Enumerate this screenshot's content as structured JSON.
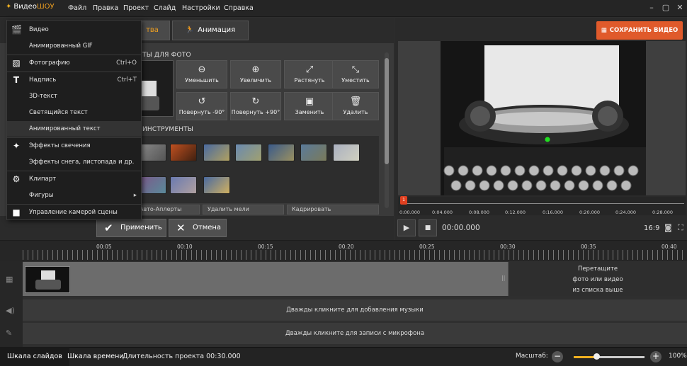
{
  "app": {
    "title_prefix": "Видео",
    "title_suffix": "ШОУ"
  },
  "menu": [
    "Файл",
    "Правка",
    "Проект",
    "Слайд",
    "Настройки",
    "Справка"
  ],
  "tabs": {
    "active_partial": "тва",
    "animation": "Анимация"
  },
  "sections": {
    "photo_actions": "ТЫ ДЛЯ ФОТО",
    "tools": "ИНСТРУМЕНТЫ"
  },
  "tools": [
    {
      "label": "Уменьшить",
      "icon": "zoom-out-icon"
    },
    {
      "label": "Увеличить",
      "icon": "zoom-in-icon"
    },
    {
      "label": "Растянуть",
      "icon": "stretch-icon"
    },
    {
      "label": "Уместить",
      "icon": "fit-icon"
    },
    {
      "label": "Повернуть -90°",
      "icon": "rotate-left-icon"
    },
    {
      "label": "Повернуть +90°",
      "icon": "rotate-right-icon"
    },
    {
      "label": "Заменить",
      "icon": "replace-image-icon"
    },
    {
      "label": "Удалить",
      "icon": "trash-icon"
    }
  ],
  "bottom_tools": [
    "Авто-Аплерты",
    "Удалить мели",
    "Кадрировать"
  ],
  "dropdown": [
    {
      "label": "Видео",
      "shortcut": "",
      "icon": "video-icon"
    },
    {
      "label": "Анимированный GIF",
      "shortcut": "",
      "icon": ""
    },
    {
      "label": "Фотографию",
      "shortcut": "Ctrl+O",
      "icon": "photo-icon"
    },
    {
      "label": "Надпись",
      "shortcut": "Ctrl+T",
      "icon": "text-icon"
    },
    {
      "label": "3D-текст",
      "shortcut": "",
      "icon": ""
    },
    {
      "label": "Светящийся текст",
      "shortcut": "",
      "icon": ""
    },
    {
      "label": "Анимированный текст",
      "shortcut": "",
      "icon": ""
    },
    {
      "label": "Эффекты свечения",
      "shortcut": "",
      "icon": "magic-wand-icon"
    },
    {
      "label": "Эффекты снега, листопада и др.",
      "shortcut": "",
      "icon": ""
    },
    {
      "label": "Клипарт",
      "shortcut": "",
      "icon": "gear-icon"
    },
    {
      "label": "Фигуры",
      "shortcut": "",
      "icon": ""
    },
    {
      "label": "Управление камерой сцены",
      "shortcut": "",
      "icon": "camera-icon"
    }
  ],
  "actions": {
    "apply": "Применить",
    "cancel": "Отмена"
  },
  "preview": {
    "save_label": "СОХРАНИТЬ ВИДЕО",
    "marker": "1",
    "ruler_ticks": [
      "0:00.000",
      "0:04.000",
      "0:08.000",
      "0:12.000",
      "0:16.000",
      "0:20.000",
      "0:24.000",
      "0:28.000"
    ],
    "timecode": "00:00.000",
    "aspect": "16:9"
  },
  "timeline": {
    "ticks": [
      "00:05",
      "00:10",
      "00:15",
      "00:20",
      "00:25",
      "00:30",
      "00:35",
      "00:40"
    ],
    "dropzone": [
      "Перетащите",
      "фото или видео",
      "из списка выше"
    ],
    "music": "Дважды кликните для добавления музыки",
    "mic": "Дважды кликните для записи с микрофона"
  },
  "status": {
    "tab_slides": "Шкала слайдов",
    "tab_timeline": "Шкала времени",
    "duration": "Длительность проекта 00:30.000",
    "zoom_label": "Масштаб:",
    "zoom_pct": "100%",
    "zoom_level": 0.32
  },
  "colors": {
    "accent": "#f0a020",
    "save": "#e05a2b"
  }
}
